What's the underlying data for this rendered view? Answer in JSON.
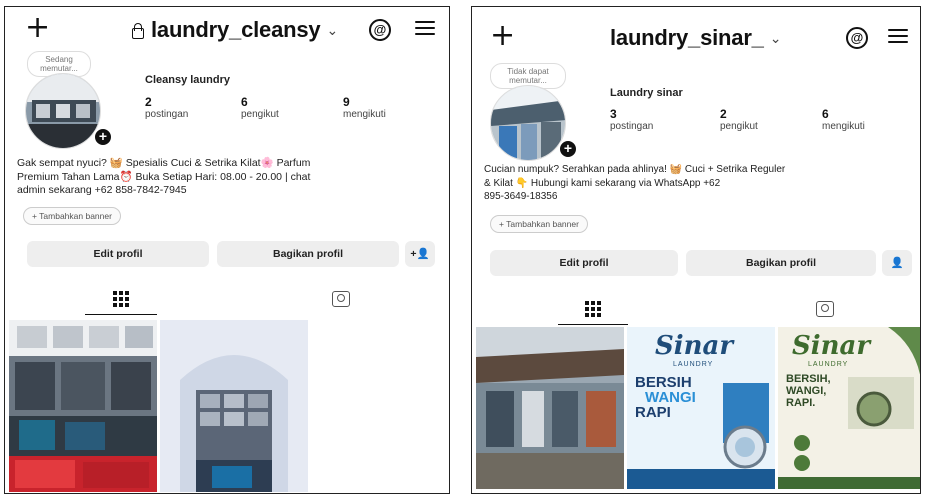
{
  "profiles": [
    {
      "plus_icon": "+",
      "username": "laundry_cleansy",
      "note": "Sedang memutar...",
      "display_name": "Cleansy laundry",
      "stats": [
        {
          "num": "2",
          "label": "postingan"
        },
        {
          "num": "6",
          "label": "pengikut"
        },
        {
          "num": "9",
          "label": "mengikuti"
        }
      ],
      "bio_lines": [
        "Gak sempat nyuci? 🧺 Spesialis Cuci & Setrika Kilat🌸 Parfum",
        "Premium Tahan Lama⏰ Buka Setiap Hari: 08.00 - 20.00 | chat",
        "admin sekarang +62 858-7842-7945"
      ],
      "banner": "+ Tambahkan banner",
      "edit_button": "Edit profil",
      "share_button": "Bagikan profil",
      "add_person_icon": "+👤",
      "colors": {
        "post1": "#5a6a7a",
        "post2": "#d8e0ec"
      }
    },
    {
      "plus_icon": "+",
      "username": "laundry_sinar_",
      "note": "Tidak dapat memutar...",
      "display_name": "Laundry sinar",
      "stats": [
        {
          "num": "3",
          "label": "postingan"
        },
        {
          "num": "2",
          "label": "pengikut"
        },
        {
          "num": "6",
          "label": "mengikuti"
        }
      ],
      "bio_lines": [
        "Cucian numpuk? Serahkan pada ahlinya! 🧺 Cuci + Setrika Reguler",
        "& Kilat 👇 Hubungi kami sekarang via WhatsApp +62",
        "895-3649-18356"
      ],
      "banner": "+ Tambahkan banner",
      "edit_button": "Edit profil",
      "share_button": "Bagikan profil",
      "add_person_icon": "👤",
      "posts": [
        {
          "title": ""
        },
        {
          "title": "Sinar",
          "sub": "LAUNDRY",
          "headline": [
            "BERSIH",
            "WANGI",
            "RAPI"
          ]
        },
        {
          "title": "Sinar",
          "sub": "LAUNDRY",
          "headline": [
            "BERSIH,",
            "WANGI,",
            "RAPI."
          ]
        }
      ]
    }
  ]
}
